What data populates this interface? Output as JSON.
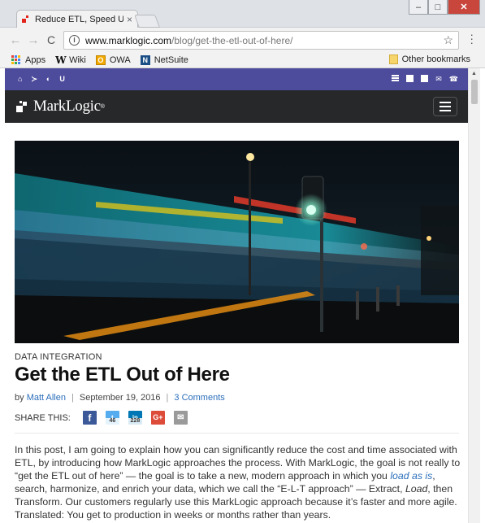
{
  "browser": {
    "tab_title": "Reduce ETL, Speed Up D",
    "tab_close": "×",
    "window_buttons": {
      "minimize": "–",
      "maximize": "□",
      "close": "✕"
    },
    "back": "←",
    "forward": "→",
    "reload": "C",
    "url_host": "www.marklogic.com",
    "url_path": "/blog/get-the-etl-out-of-here/",
    "star": "☆",
    "menu": "⋮",
    "bookmarks": [
      {
        "label": "Apps",
        "icon": "apps-grid-icon"
      },
      {
        "label": "Wiki",
        "icon": "wikipedia-icon"
      },
      {
        "label": "OWA",
        "icon": "outlook-icon"
      },
      {
        "label": "NetSuite",
        "icon": "netsuite-icon"
      }
    ],
    "other_bookmarks": "Other bookmarks"
  },
  "site": {
    "util_left_icons": [
      "home-icon",
      "terminal-icon",
      "globe-icon",
      "university-icon"
    ],
    "util_left_glyphs": [
      "⌂",
      "≻",
      "◐",
      "U"
    ],
    "util_right_icons": [
      "news-icon",
      "document-icon",
      "page-icon",
      "email-icon",
      "phone-icon"
    ],
    "util_right_glyphs": [
      "",
      "",
      "",
      "✉",
      "☎"
    ],
    "logo_text": "MarkLogic",
    "logo_tm": "®",
    "brand_color": "#4d4b9c"
  },
  "post": {
    "category": "DATA INTEGRATION",
    "title": "Get the ETL Out of Here",
    "by": "by",
    "author": "Matt Allen",
    "date": "September 19, 2016",
    "comments": "3 Comments",
    "share_label": "SHARE THIS:",
    "share": {
      "facebook": "f",
      "twitter": "t",
      "twitter_count": "46",
      "linkedin": "in",
      "linkedin_count": "228",
      "googleplus": "G+",
      "email": "✉"
    },
    "intro_1": "In this post, I am going to explain how you can significantly reduce the cost and time associated with ETL, by introducing how MarkLogic approaches the process. With MarkLogic, the goal is not really to “get the ETL out of here” — the goal is to take a new, modern approach in which you ",
    "intro_link": "load as is",
    "intro_2": ", search, harmonize, and enrich your data, which we call the “E-L-T approach” — Extract, ",
    "intro_load": "Load",
    "intro_3": ", then Transform. Our customers regularly use this MarkLogic approach because it’s faster and more agile. Translated: You get to production in weeks or months rather than years."
  }
}
